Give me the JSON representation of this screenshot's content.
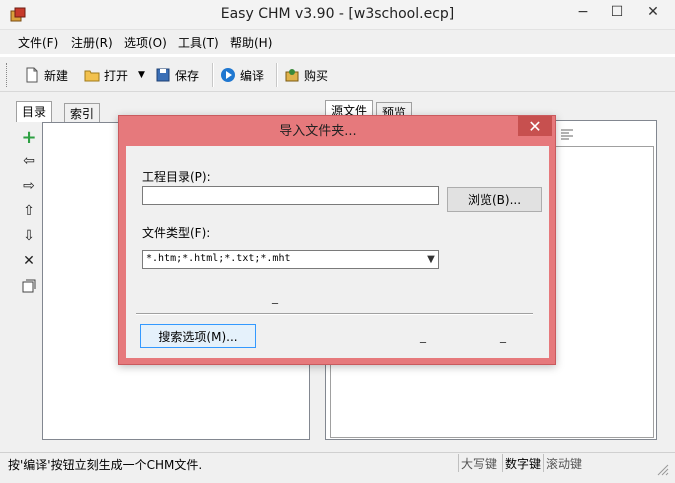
{
  "window": {
    "title": "Easy CHM v3.90 - [w3school.ecp]",
    "minimize": "−",
    "maximize": "☐",
    "close": "✕"
  },
  "menu": [
    {
      "label": "文件(F)"
    },
    {
      "label": "注册(R)"
    },
    {
      "label": "选项(O)"
    },
    {
      "label": "工具(T)"
    },
    {
      "label": "帮助(H)"
    }
  ],
  "toolbar": {
    "new": "新建",
    "open": "打开",
    "save": "保存",
    "compile": "编译",
    "buy": "购买"
  },
  "left_tabs": [
    "目录",
    "索引"
  ],
  "right_tabs": [
    "源文件",
    "预览"
  ],
  "status": {
    "message": "按'编译'按钮立刻生成一个CHM文件.",
    "caps": "大写键",
    "num": "数字键",
    "scroll": "滚动键"
  },
  "dialog": {
    "title": "导入文件夹...",
    "close": "✕",
    "dir_label": "工程目录(P):",
    "dir_value": "",
    "browse_label": "浏览(B)...",
    "type_label": "文件类型(F):",
    "type_value": "*.htm;*.html;*.txt;*.mht",
    "dash": "_",
    "search_options_label": "搜索选项(M)..."
  },
  "colors": {
    "dialog_frame": "#e6797c",
    "dialog_close": "#c7504f",
    "add_icon": "#2ea043"
  }
}
